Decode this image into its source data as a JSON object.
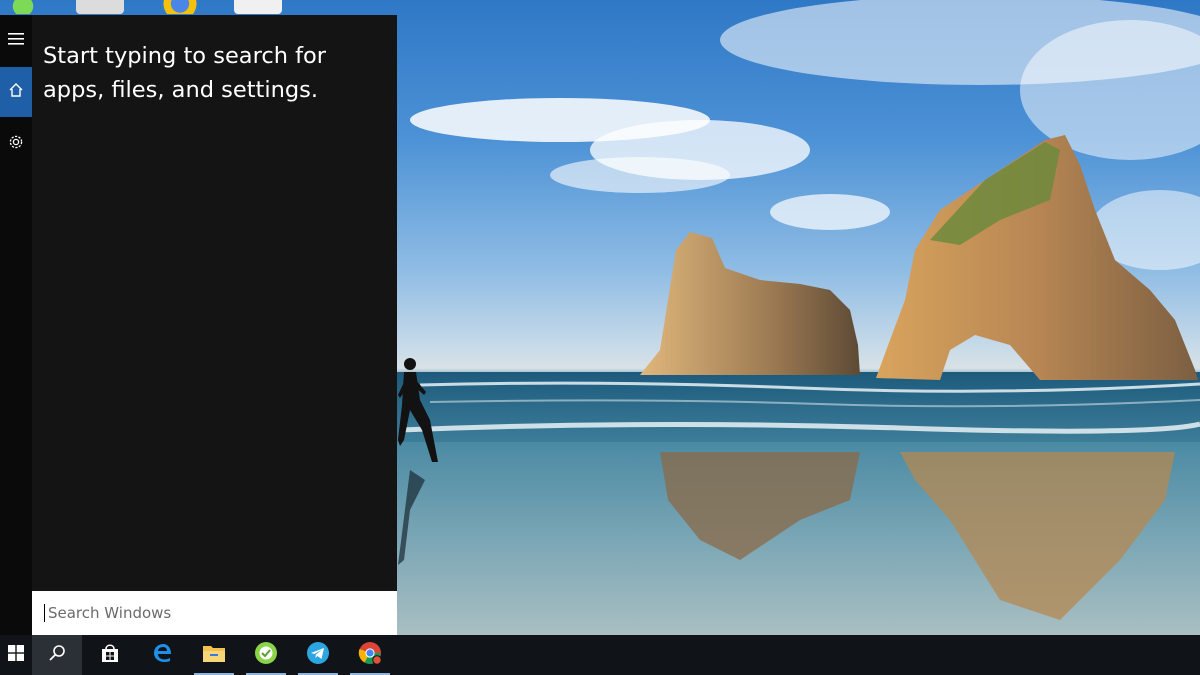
{
  "start_panel": {
    "prompt": "Start typing to search for apps, files, and settings.",
    "rail": [
      {
        "icon": "hamburger-menu-icon"
      },
      {
        "icon": "home-icon"
      },
      {
        "icon": "gear-icon"
      }
    ]
  },
  "search": {
    "placeholder": "Search Windows",
    "value": ""
  },
  "taskbar": {
    "items": [
      {
        "icon": "windows-logo-icon"
      },
      {
        "icon": "search-icon"
      },
      {
        "icon": "store-icon"
      },
      {
        "icon": "edge-icon"
      },
      {
        "icon": "file-explorer-icon"
      },
      {
        "icon": "green-app-icon"
      },
      {
        "icon": "telegram-icon"
      },
      {
        "icon": "chrome-icon"
      }
    ]
  },
  "colors": {
    "panel": "#141414",
    "rail": "#0a0a0a",
    "accent": "#1e5fa8",
    "taskbar": "#101419"
  }
}
